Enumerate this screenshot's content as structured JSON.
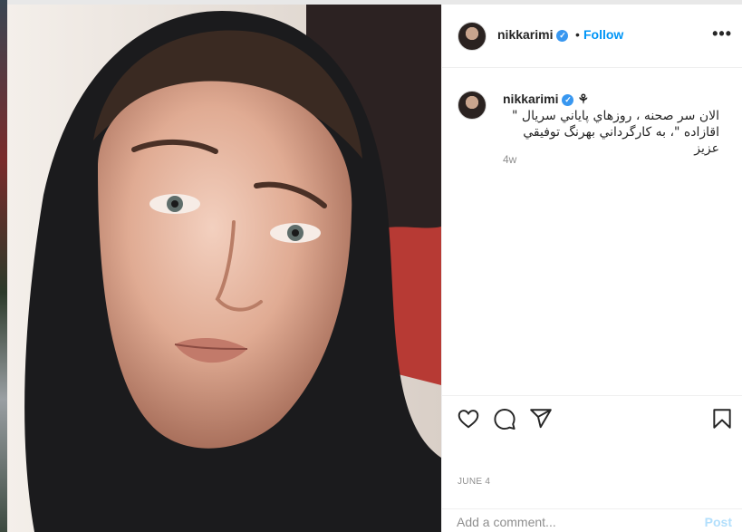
{
  "post": {
    "username": "nikkarimi",
    "verified_badge": "✓",
    "separator": "•",
    "follow_label": "Follow",
    "more_label": "•••"
  },
  "caption": {
    "username": "nikkarimi",
    "emoji": "⚘",
    "text": "الان سر صحنه ، روزهاي پاياني سريال \" اقازاده \"، به كارگرداني بهرنگ توفيقي عزيز",
    "time_ago": "4w"
  },
  "actions": {
    "icons": [
      "heart-icon",
      "comment-icon",
      "share-icon",
      "bookmark-icon"
    ]
  },
  "date_label": "JUNE 4",
  "comment": {
    "placeholder": "Add a comment...",
    "post_label": "Post"
  },
  "colors": {
    "link_blue": "#0095f6",
    "verified_blue": "#3897f0",
    "post_disabled": "#b2dffc",
    "muted_text": "#8e8e8e"
  }
}
